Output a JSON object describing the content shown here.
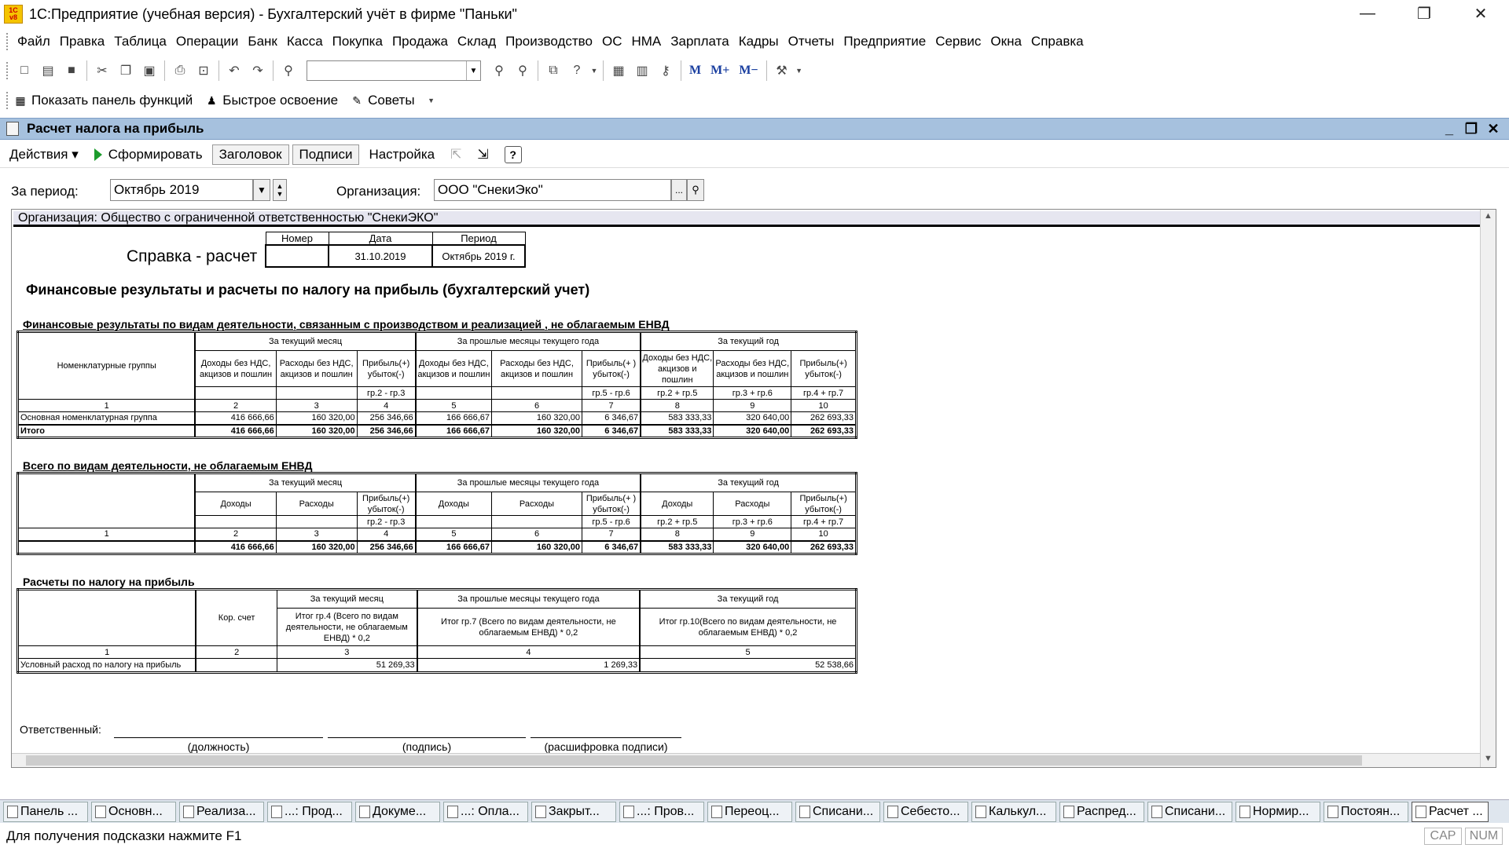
{
  "window": {
    "title": "1С:Предприятие (учебная версия) - Бухгалтерский учёт в фирме \"Паньки\"",
    "logo_text": "1С v8",
    "min": "—",
    "restore": "❐",
    "close": "✕"
  },
  "menu": [
    "Файл",
    "Правка",
    "Таблица",
    "Операции",
    "Банк",
    "Касса",
    "Покупка",
    "Продажа",
    "Склад",
    "Производство",
    "ОС",
    "НМА",
    "Зарплата",
    "Кадры",
    "Отчеты",
    "Предприятие",
    "Сервис",
    "Окна",
    "Справка"
  ],
  "toolbar": {
    "search_value": "",
    "m_buttons": [
      "M",
      "M+",
      "M−"
    ]
  },
  "toolbar2": {
    "show_panel": "Показать панель функций",
    "quick_learn": "Быстрое освоение",
    "tips": "Советы"
  },
  "doc": {
    "title": "Расчет налога на прибыль",
    "actions": "Действия ▾",
    "generate": "Сформировать",
    "header_btn": "Заголовок",
    "signs_btn": "Подписи",
    "settings": "Настройка",
    "help": "?"
  },
  "params": {
    "period_label": "За период:",
    "period_value": "Октябрь 2019",
    "org_label": "Организация:",
    "org_value": "ООО \"СнекиЭко\""
  },
  "report": {
    "org_line": "Организация: Общество с ограниченной ответственностью \"СнекиЭКО\"",
    "sprav_title": "Справка - расчет",
    "sprav_headers": [
      "Номер",
      "Дата",
      "Период"
    ],
    "sprav_values": [
      "",
      "31.10.2019",
      "Октябрь 2019 г."
    ],
    "main_title": "Финансовые результаты и расчеты по налогу на прибыль (бухгалтерский учет)",
    "sec1_title": "Финансовые результаты по видам деятельности, связанным с производством и реализацией , не облагаемым ЕНВД",
    "sec2_title": "Всего  по видам деятельности, не облагаемым ЕНВД",
    "sec3_title": "Расчеты по налогу на прибыль",
    "groups": [
      "За текущий месяц",
      "За прошлые месяцы текущего года",
      "За текущий год"
    ],
    "t1": {
      "nom_header": "Номенклатурные группы",
      "col_heads": [
        "Доходы без НДС, акцизов и пошлин",
        "Расходы без НДС, акцизов и пошлин",
        "Прибыль(+) убыток(-)",
        "Доходы без НДС, акцизов и пошлин",
        "Расходы без НДС, акцизов и пошлин",
        "Прибыль(+ ) убыток(-)",
        "Доходы без НДС, акцизов и пошлин",
        "Расходы без НДС, акцизов и пошлин",
        "Прибыль(+) убыток(-)"
      ],
      "formulas": [
        "",
        "",
        "гр.2 - гр.3",
        "",
        "",
        "гр.5 - гр.6",
        "гр.2 + гр.5",
        "гр.3 + гр.6",
        "гр.4 + гр.7"
      ],
      "nums": [
        "1",
        "2",
        "3",
        "4",
        "5",
        "6",
        "7",
        "8",
        "9",
        "10"
      ],
      "row_label": "Основная номенклатурная группа",
      "row": [
        "416 666,66",
        "160 320,00",
        "256 346,66",
        "166 666,67",
        "160 320,00",
        "6 346,67",
        "583 333,33",
        "320 640,00",
        "262 693,33"
      ],
      "total_label": "Итого",
      "total": [
        "416 666,66",
        "160 320,00",
        "256 346,66",
        "166 666,67",
        "160 320,00",
        "6 346,67",
        "583 333,33",
        "320 640,00",
        "262 693,33"
      ]
    },
    "t2": {
      "col_heads": [
        "Доходы",
        "Расходы",
        "Прибыль(+) убыток(-)",
        "Доходы",
        "Расходы",
        "Прибыль(+ ) убыток(-)",
        "Доходы",
        "Расходы",
        "Прибыль(+) убыток(-)"
      ],
      "formulas": [
        "",
        "",
        "гр.2 - гр.3",
        "",
        "",
        "гр.5 - гр.6",
        "гр.2 + гр.5",
        "гр.3 + гр.6",
        "гр.4 + гр.7"
      ],
      "nums": [
        "1",
        "2",
        "3",
        "4",
        "5",
        "6",
        "7",
        "8",
        "9",
        "10"
      ],
      "total": [
        "416 666,66",
        "160 320,00",
        "256 346,66",
        "166 666,67",
        "160 320,00",
        "6 346,67",
        "583 333,33",
        "320 640,00",
        "262 693,33"
      ]
    },
    "t3": {
      "kor_schet": "Кор. счет",
      "col3": "Итог гр.4 (Всего  по видам деятельности, не облагаемым ЕНВД) * 0,2",
      "col4": "Итог гр.7 (Всего  по видам деятельности, не облагаемым ЕНВД) * 0,2",
      "col5": "Итог гр.10(Всего  по видам деятельности, не облагаемым ЕНВД) * 0,2",
      "nums": [
        "1",
        "2",
        "3",
        "4",
        "5"
      ],
      "row_label": "Условный расход по налогу на прибыль",
      "row": [
        "",
        "51 269,33",
        "1 269,33",
        "52 538,66"
      ]
    },
    "sign": {
      "label": "Ответственный:",
      "c1": "(должность)",
      "c2": "(подпись)",
      "c3": "(расшифровка подписи)"
    }
  },
  "taskbar": [
    "Панель ...",
    "Основн...",
    "Реализа...",
    "...: Прод...",
    "Докуме...",
    "...: Опла...",
    "Закрыт...",
    "...: Пров...",
    "Переоц...",
    "Списани...",
    "Себесто...",
    "Калькул...",
    "Распред...",
    "Списани...",
    "Нормир...",
    "Постоян...",
    "Расчет ..."
  ],
  "status": {
    "hint": "Для получения подсказки нажмите F1",
    "cap": "CAP",
    "num": "NUM"
  }
}
